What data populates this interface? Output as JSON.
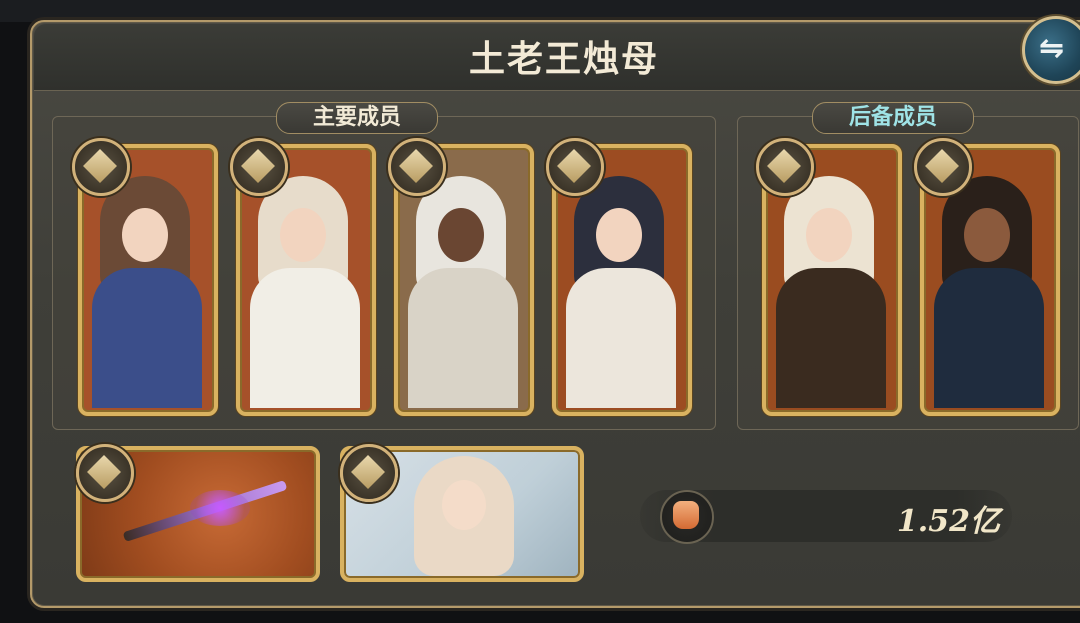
{
  "title": "土老王烛母",
  "main_members": {
    "label": "主要成员",
    "cards": [
      {
        "name": "character-card-1",
        "hair": "#6b4a36",
        "bg": "#a6512a",
        "outfit": "#3b4e8a"
      },
      {
        "name": "character-card-2",
        "hair": "#e7dccb",
        "bg": "#a6512a",
        "outfit": "#f1eee6"
      },
      {
        "name": "character-card-3",
        "hair": "#e8e5de",
        "bg": "#8a6b4b",
        "outfit": "#d9d3c7"
      },
      {
        "name": "character-card-4",
        "hair": "#2c2f3d",
        "bg": "#9c4c22",
        "outfit": "#ece6dc"
      }
    ]
  },
  "reserve_members": {
    "label": "后备成员",
    "cards": [
      {
        "name": "character-card-5",
        "hair": "#ece3d2",
        "bg": "#9a4c20",
        "outfit": "#3a2b1f"
      },
      {
        "name": "character-card-6",
        "hair": "#2a201a",
        "bg": "#9a4c20",
        "outfit": "#1f2c3e"
      }
    ]
  },
  "power": {
    "value": "1.52亿"
  },
  "icons": {
    "swap": "swap-arrows-icon",
    "badge": "class-badge-icon",
    "power": "fist-power-icon"
  }
}
